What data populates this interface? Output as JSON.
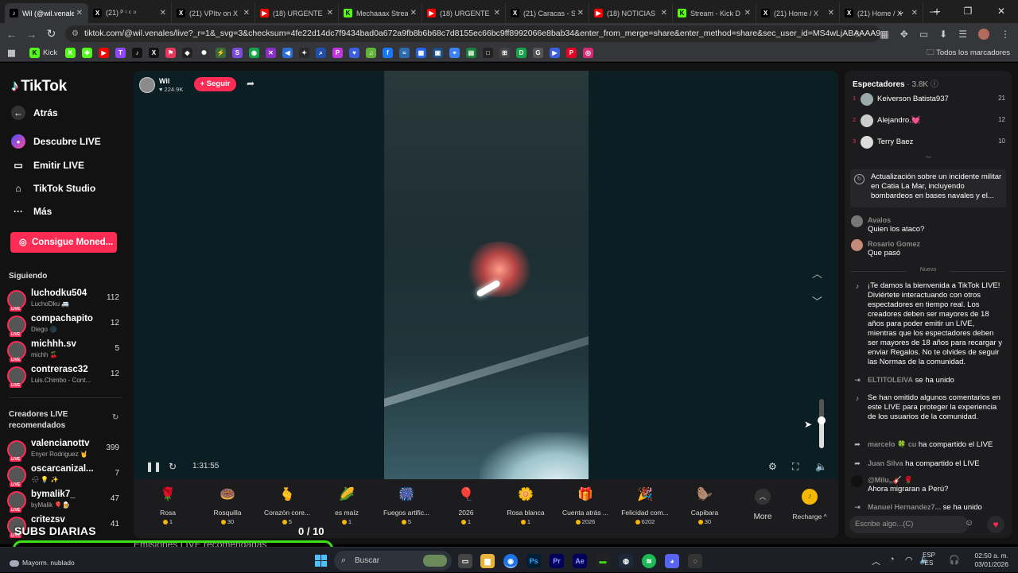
{
  "browser": {
    "tabs": [
      {
        "title": "Wil (@wil.venales)",
        "icon": "tiktok-icon",
        "color": "#000000",
        "active": true
      },
      {
        "title": "(21) ᴾ ⁱ ᶜ ᵘ",
        "icon": "x-icon",
        "color": "#000000"
      },
      {
        "title": "(21) VPItv on X",
        "icon": "x-icon",
        "color": "#000000"
      },
      {
        "title": "(18) URGENTE",
        "icon": "youtube-icon",
        "color": "#ff0000"
      },
      {
        "title": "Mechaaax Stream",
        "icon": "kick-icon",
        "color": "#53fc18"
      },
      {
        "title": "(18) URGENTE",
        "icon": "youtube-icon",
        "color": "#ff0000"
      },
      {
        "title": "(21) Caracas - S",
        "icon": "x-icon",
        "color": "#000000"
      },
      {
        "title": "(18) NOTICIAS",
        "icon": "youtube-icon",
        "color": "#ff0000"
      },
      {
        "title": "Stream - Kick D",
        "icon": "kick-icon",
        "color": "#53fc18"
      },
      {
        "title": "(21) Home / X",
        "icon": "x-icon",
        "color": "#000000"
      },
      {
        "title": "(21) Home / X",
        "icon": "x-icon",
        "color": "#000000"
      }
    ],
    "url": "tiktok.com/@wil.venales/live?_r=1&_svg=3&checksum=4fe22d14dc7f9434bad0a672a9fb8b6b68c7d8155ec66bc9ff8992066e8bab34&enter_from_merge=share&enter_method=share&sec_user_id=MS4wLjABAAAA9ZAsnC2PdecqD0HR...",
    "bookmarks": {
      "kick_label": "Kick",
      "all_label": "Todos los marcadores",
      "icons": [
        {
          "name": "kick2-bookmark-icon",
          "color": "#53fc18",
          "glyph": "K"
        },
        {
          "name": "clover-bookmark-icon",
          "color": "#53fc18",
          "glyph": "✤"
        },
        {
          "name": "youtube-bookmark-icon",
          "color": "#ff0000",
          "glyph": "▶"
        },
        {
          "name": "twitch-bookmark-icon",
          "color": "#9146ff",
          "glyph": "T"
        },
        {
          "name": "tiktok-bookmark-icon",
          "color": "#111111",
          "glyph": "♪"
        },
        {
          "name": "x-bookmark-icon",
          "color": "#111111",
          "glyph": "X"
        },
        {
          "name": "flag-bookmark-icon",
          "color": "#e8365d",
          "glyph": "⚑"
        },
        {
          "name": "diamond-bookmark-icon",
          "color": "#222222",
          "glyph": "◆"
        },
        {
          "name": "chatgpt-bookmark-icon",
          "color": "#333333",
          "glyph": "✺"
        },
        {
          "name": "bolt-bookmark-icon",
          "color": "#3a6b35",
          "glyph": "⚡"
        },
        {
          "name": "s-bookmark-icon",
          "color": "#7b4bd9",
          "glyph": "S"
        },
        {
          "name": "green-bookmark-icon",
          "color": "#16a34a",
          "glyph": "◉"
        },
        {
          "name": "cross-bookmark-icon",
          "color": "#8b2fc9",
          "glyph": "✕"
        },
        {
          "name": "fish-bookmark-icon",
          "color": "#2a6fd6",
          "glyph": "◀"
        },
        {
          "name": "star-bookmark-icon",
          "color": "#2a2a2a",
          "glyph": "✦"
        },
        {
          "name": "search-bookmark-icon",
          "color": "#1e4fae",
          "glyph": "⌕"
        },
        {
          "name": "p-bookmark-icon",
          "color": "#c235e3",
          "glyph": "P"
        },
        {
          "name": "heart-bookmark-icon",
          "color": "#3b5fe0",
          "glyph": "♥"
        },
        {
          "name": "note-bookmark-icon",
          "color": "#62b33a",
          "glyph": "♫"
        },
        {
          "name": "facebook-bookmark-icon",
          "color": "#1877f2",
          "glyph": "f"
        },
        {
          "name": "sky-bookmark-icon",
          "color": "#2b6cb0",
          "glyph": "≈"
        },
        {
          "name": "grid-bookmark-icon",
          "color": "#2563eb",
          "glyph": "▦"
        },
        {
          "name": "photo-bookmark-icon",
          "color": "#1d4e89",
          "glyph": "▣"
        },
        {
          "name": "map-bookmark-icon",
          "color": "#3b82f6",
          "glyph": "⌖"
        },
        {
          "name": "sheet-bookmark-icon",
          "color": "#188038",
          "glyph": "▤"
        },
        {
          "name": "square-bookmark-icon",
          "color": "#222222",
          "glyph": "□"
        },
        {
          "name": "db-bookmark-icon",
          "color": "#444444",
          "glyph": "⊞"
        },
        {
          "name": "d-bookmark-icon",
          "color": "#16a34a",
          "glyph": "D"
        },
        {
          "name": "google-bookmark-icon",
          "color": "#555555",
          "glyph": "G"
        },
        {
          "name": "flag2-bookmark-icon",
          "color": "#3b5fe0",
          "glyph": "▶"
        },
        {
          "name": "pinterest-bookmark-icon",
          "color": "#e60023",
          "glyph": "P"
        },
        {
          "name": "instagram2-bookmark-icon",
          "color": "#d62976",
          "glyph": "◎"
        }
      ]
    }
  },
  "sidebar": {
    "logo": "TikTok",
    "nav": [
      {
        "label": "Atrás",
        "icon": "back-arrow-icon"
      },
      {
        "label": "Descubre LIVE",
        "icon": "live-discover-icon"
      },
      {
        "label": "Emitir LIVE",
        "icon": "camera-icon"
      },
      {
        "label": "TikTok Studio",
        "icon": "home-icon"
      },
      {
        "label": "Más",
        "icon": "more-dots-icon"
      }
    ],
    "coins_button": "Consigue Moned...",
    "following_title": "Siguiendo",
    "following": [
      {
        "name": "luchodku504",
        "sub": "LuchoDku 🚐",
        "count": "112"
      },
      {
        "name": "compachapito",
        "sub": "Diego 🌑",
        "count": "12"
      },
      {
        "name": "michhh.sv",
        "sub": "michh 🍒",
        "count": "5"
      },
      {
        "name": "contrerasc32",
        "sub": "Luis.Chimbo - Cont...",
        "count": "12"
      }
    ],
    "recommended_title": "Creadores LIVE recomendados",
    "recommended": [
      {
        "name": "valencianottv",
        "sub": "Enyer Rodriguez 🤘",
        "count": "399"
      },
      {
        "name": "oscarcanizal...",
        "sub": "🌧 💡 ✨",
        "count": "7"
      },
      {
        "name": "bymalik7_",
        "sub": "byMalik 🎈🍺",
        "count": "47"
      },
      {
        "name": "critezsv",
        "sub": "",
        "count": "41"
      }
    ]
  },
  "player": {
    "streamer_name": "Wil",
    "likes": "224.9K",
    "follow_label": "+ Seguir",
    "time": "1:31:55"
  },
  "gifts": [
    {
      "name": "Rosa",
      "price": "1",
      "glyph": "🌹"
    },
    {
      "name": "Rosquilla",
      "price": "30",
      "glyph": "🍩"
    },
    {
      "name": "Corazón core...",
      "price": "5",
      "glyph": "🫰"
    },
    {
      "name": "es maíz",
      "price": "1",
      "glyph": "🌽"
    },
    {
      "name": "Fuegos artific...",
      "price": "5",
      "glyph": "🎆"
    },
    {
      "name": "2026",
      "price": "1",
      "glyph": "🎈"
    },
    {
      "name": "Rosa blanca",
      "price": "1",
      "glyph": "🌼"
    },
    {
      "name": "Cuenta atrás ...",
      "price": "2026",
      "glyph": "🎁"
    },
    {
      "name": "Felicidad com...",
      "price": "6202",
      "glyph": "🎉"
    },
    {
      "name": "Capibara",
      "price": "30",
      "glyph": "🦫"
    }
  ],
  "gifts_more": "More",
  "recharge": "Recharge ^",
  "right": {
    "spectators_label": "Espectadores",
    "spectators_count": "· 3.8K",
    "top_viewers": [
      {
        "rank": "1",
        "name": "Keiverson Batista937",
        "score": "21"
      },
      {
        "rank": "2",
        "name": "Alejandro.💓",
        "score": "12"
      },
      {
        "rank": "3",
        "name": "Terry Baez",
        "score": "10"
      }
    ],
    "notice": "Actualización sobre un incidente militar en Catia La Mar, incluyendo bombardeos en bases navales y el...",
    "comments_old": [
      {
        "user": "Avalos",
        "text": "Quien los ataco?"
      },
      {
        "user": "Rosario Gomez",
        "text": "Que pasó"
      }
    ],
    "new_label": "Nuevo",
    "welcome": "¡Te damos la bienvenida a TikTok LIVE! Diviértete interactuando con otros espectadores en tiempo real. Los creadores deben ser mayores de 18 años para poder emitir un LIVE, mientras que los espectadores deben ser mayores de 18 años para recargar y enviar Regalos. No te olvides de seguir las Normas de la comunidad.",
    "join1_user": "ELTITOLEIVA",
    "join1_text": "se ha unido",
    "omitted": "Se han omitido algunos comentarios en este LIVE para proteger la experiencia de los usuarios de la comunidad.",
    "share1_user": "marcelo 🍀 cu",
    "share1_text": "ha compartido el LIVE",
    "share2_user": "Juan Silva",
    "share2_text": "ha compartido el LIVE",
    "milu_user": "@Milu,,🎸 🌹",
    "milu_text": "Ahora migraran a Perú?",
    "join2_user": "Manuel Hernandez7...",
    "join2_text": "se ha unido",
    "input_placeholder": "Escribe algo...(C)"
  },
  "overlay": {
    "subs_label": "SUBS DIARIAS",
    "subs_counter": "0  / 10",
    "recommended_streams": "Emisiones LIVE recomendadas",
    "progress": 0
  },
  "taskbar": {
    "weather": "Mayorm. nublado",
    "search": "Buscar",
    "lang1": "ESP",
    "lang2": "ES",
    "time": "02:50 a. m.",
    "date": "03/01/2026"
  }
}
